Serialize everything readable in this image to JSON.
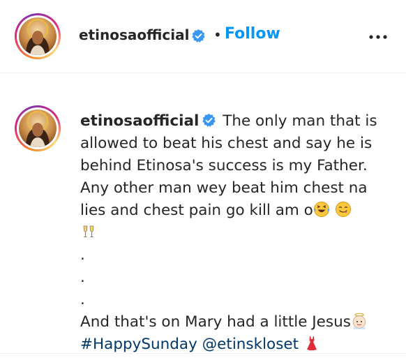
{
  "header": {
    "username": "etinosaofficial",
    "separator": "•",
    "follow_label": "Follow"
  },
  "caption": {
    "username": "etinosaofficial",
    "line1": "The only man that is",
    "line2": "allowed to beat his chest and say he is",
    "line3": "behind Etinosa's success is my Father.",
    "line4": "Any other man wey beat him chest na",
    "line5": "lies and chest pain go kill am o",
    "dot1": ".",
    "dot2": ".",
    "dot3": ".",
    "line6": "And that's on Mary had a little Jesus",
    "hashtag": "#HappySunday",
    "mention": "@etinskloset"
  },
  "icons": {
    "verified": "verified-badge-icon",
    "more": "more-options-icon",
    "emojis": [
      "laughing-tears-emoji",
      "yum-face-emoji",
      "clinking-glasses-emoji",
      "baby-angel-emoji",
      "red-dress-emoji"
    ]
  },
  "colors": {
    "follow": "#0095f6",
    "verified": "#3897f0",
    "link": "#00376b",
    "text": "#262626"
  }
}
